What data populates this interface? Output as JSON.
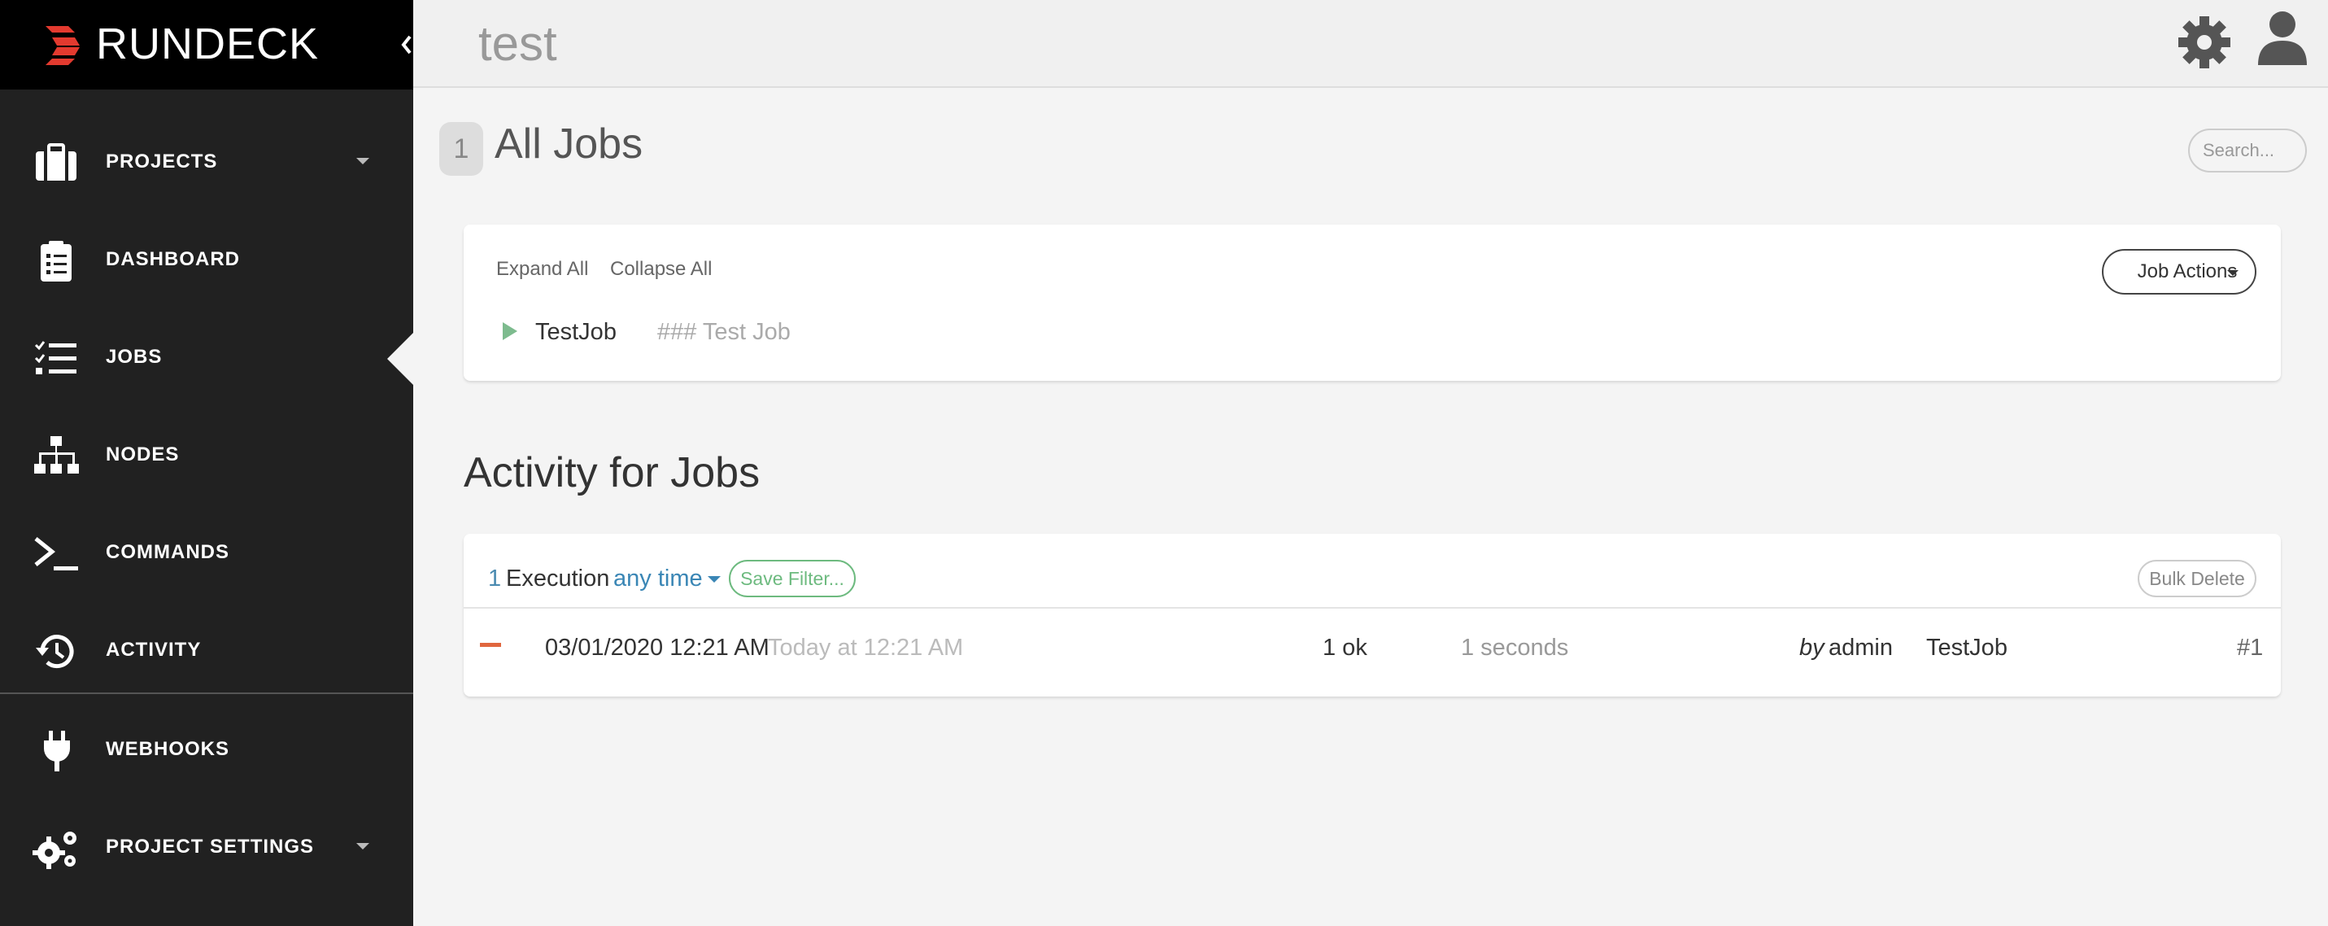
{
  "brand": {
    "name": "RUNDECK",
    "logo_color": "#e33a2f"
  },
  "sidebar": {
    "items": [
      {
        "label": "PROJECTS",
        "icon": "briefcase-icon",
        "has_dropdown": true
      },
      {
        "label": "DASHBOARD",
        "icon": "clipboard-icon",
        "has_dropdown": false
      },
      {
        "label": "JOBS",
        "icon": "tasks-icon",
        "has_dropdown": false,
        "active": true
      },
      {
        "label": "NODES",
        "icon": "sitemap-icon",
        "has_dropdown": false
      },
      {
        "label": "COMMANDS",
        "icon": "terminal-icon",
        "has_dropdown": false
      },
      {
        "label": "ACTIVITY",
        "icon": "history-icon",
        "has_dropdown": false
      },
      {
        "label": "WEBHOOKS",
        "icon": "plug-icon",
        "has_dropdown": false
      },
      {
        "label": "PROJECT SETTINGS",
        "icon": "cogs-icon",
        "has_dropdown": true
      }
    ]
  },
  "header": {
    "project_name": "test"
  },
  "jobs": {
    "count": "1",
    "heading": "All Jobs",
    "search_placeholder": "Search...",
    "expand_all": "Expand All",
    "collapse_all": "Collapse All",
    "job_actions": "Job Actions",
    "list": [
      {
        "name": "TestJob",
        "description": "### Test Job"
      }
    ]
  },
  "activity": {
    "heading": "Activity for Jobs",
    "execution_count": "1",
    "execution_label": "Execution",
    "time_filter": "any time",
    "save_filter": "Save Filter...",
    "bulk_delete": "Bulk Delete",
    "rows": [
      {
        "date": "03/01/2020 12:21 AM",
        "relative": "Today at 12:21 AM",
        "result": "1 ok",
        "duration": "1 seconds",
        "by_label": "by",
        "user": "admin",
        "job": "TestJob",
        "number": "#1",
        "status_color": "#e0663e"
      }
    ]
  },
  "colors": {
    "sidebar_bg": "#212121",
    "brand_bg": "#000000",
    "link_blue": "#3a86b5",
    "success_green": "#6dba7f"
  }
}
